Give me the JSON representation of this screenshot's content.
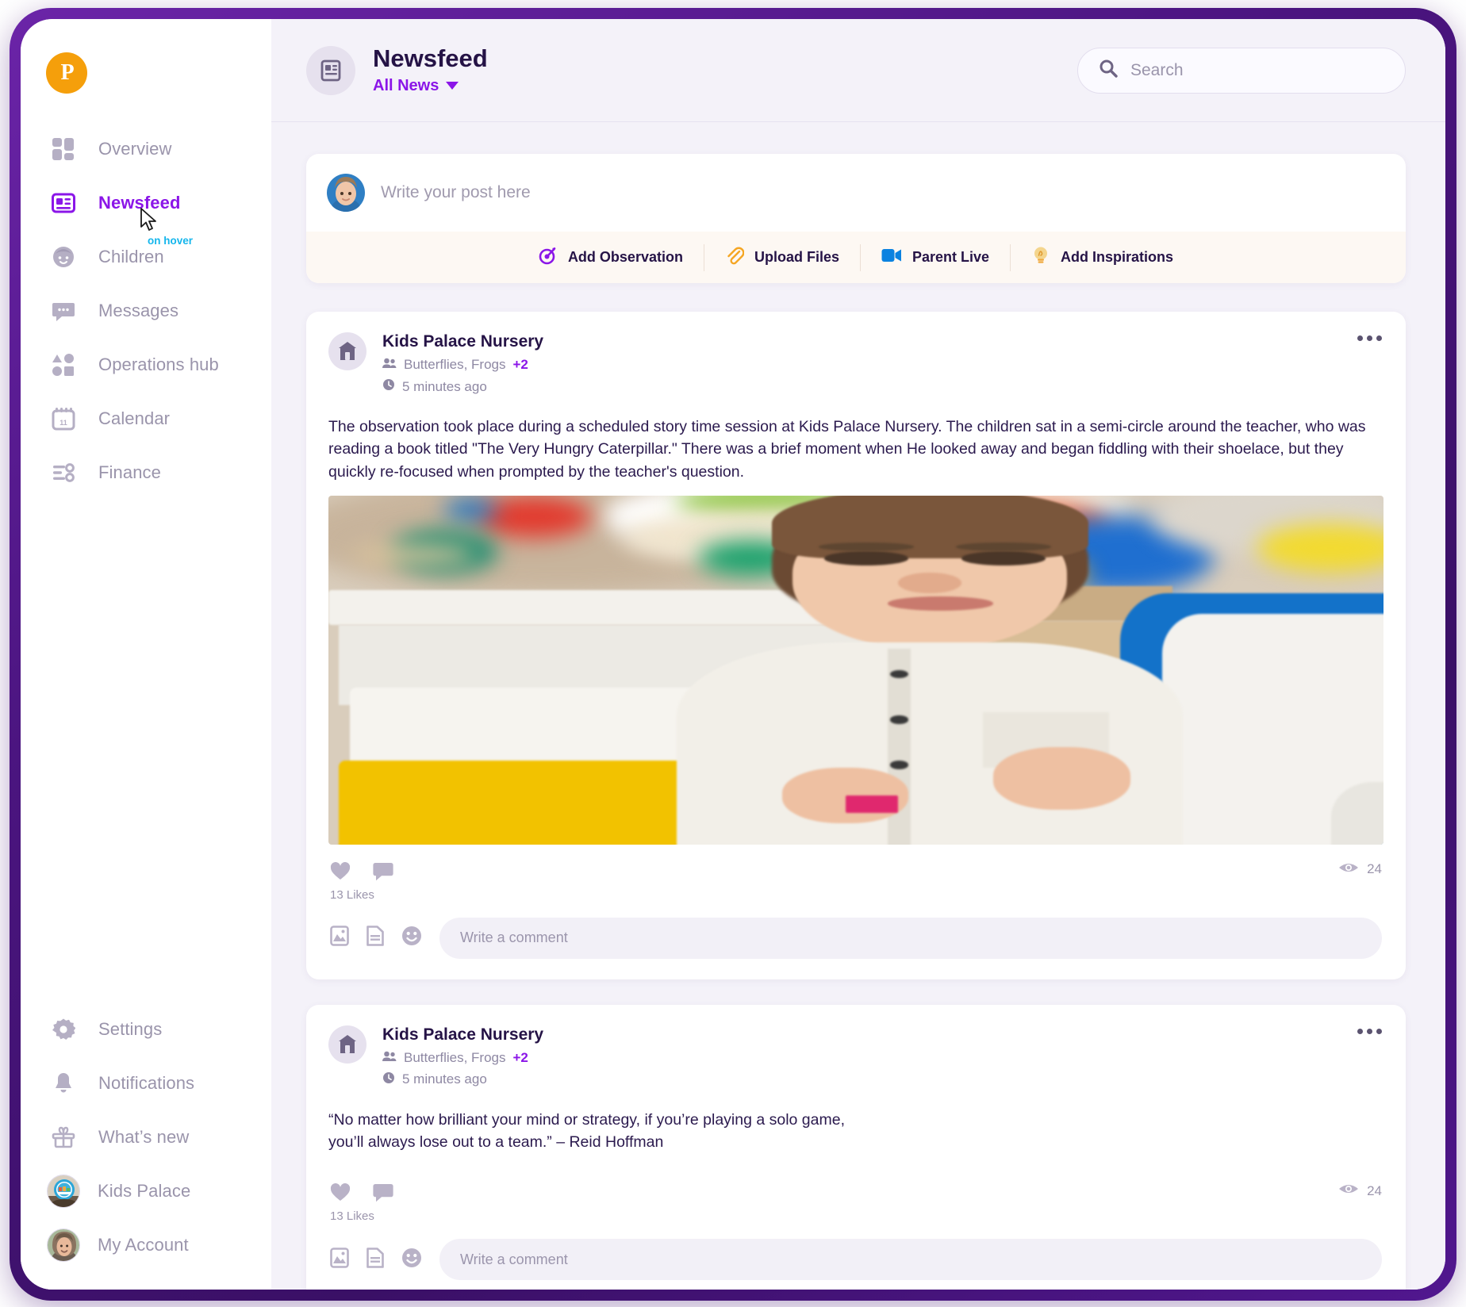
{
  "brand": {
    "logo_letter": "P",
    "logo_color": "#f59f0b",
    "accent": "#8b16e8",
    "hover_tag_color": "#15b6ec"
  },
  "sidebar": {
    "hover_hint": "on hover",
    "top_items": [
      {
        "label": "Overview",
        "icon": "grid-icon",
        "active": false
      },
      {
        "label": "Newsfeed",
        "icon": "newsfeed-icon",
        "active": true
      },
      {
        "label": "Children",
        "icon": "child-face-icon",
        "active": false
      },
      {
        "label": "Messages",
        "icon": "chat-bubble-icon",
        "active": false
      },
      {
        "label": "Operations hub",
        "icon": "shapes-icon",
        "active": false
      },
      {
        "label": "Calendar",
        "icon": "calendar-icon",
        "active": false
      },
      {
        "label": "Finance",
        "icon": "finance-icon",
        "active": false
      }
    ],
    "bottom_items": [
      {
        "label": "Settings",
        "icon": "gear-icon"
      },
      {
        "label": "Notifications",
        "icon": "bell-icon"
      },
      {
        "label": "What’s new",
        "icon": "gift-icon"
      },
      {
        "label": "Kids Palace",
        "icon": "nursery-avatar"
      },
      {
        "label": "My Account",
        "icon": "user-avatar"
      }
    ]
  },
  "header": {
    "title": "Newsfeed",
    "filter_label": "All News",
    "page_icon": "newsfeed-icon"
  },
  "search": {
    "placeholder": "Search",
    "value": ""
  },
  "composer": {
    "placeholder": "Write your post here",
    "actions": [
      {
        "label": "Add Observation",
        "icon": "target-icon",
        "color": "#8b16e8"
      },
      {
        "label": "Upload Files",
        "icon": "paperclip-icon",
        "color": "#f5a623"
      },
      {
        "label": "Parent Live",
        "icon": "video-camera-icon",
        "color": "#0b82e0"
      },
      {
        "label": "Add Inspirations",
        "icon": "lightbulb-icon",
        "color": "#f2c75c"
      }
    ]
  },
  "posts": [
    {
      "author": "Kids Palace Nursery",
      "groups": "Butterflies, Frogs",
      "extra_groups": "+2",
      "time": "5 minutes ago",
      "body": "The observation took place during a scheduled story time session at Kids Palace Nursery. The children sat in a semi-circle around the teacher, who was reading a book titled \"The Very Hungry Caterpillar.\" There was a brief moment when He looked away and began fiddling with their shoelace, but they quickly re-focused when prompted by the teacher's question.",
      "has_photo": true,
      "likes": "13 Likes",
      "views": "24",
      "comment_placeholder": "Write a comment"
    },
    {
      "author": "Kids Palace Nursery",
      "groups": "Butterflies, Frogs",
      "extra_groups": "+2",
      "time": "5 minutes ago",
      "body": "“No matter how brilliant your mind or strategy, if you’re playing a solo game,\nyou’ll always lose out to a team.” – Reid Hoffman",
      "has_photo": false,
      "likes": "13 Likes",
      "views": "24",
      "comment_placeholder": "Write a comment"
    }
  ]
}
